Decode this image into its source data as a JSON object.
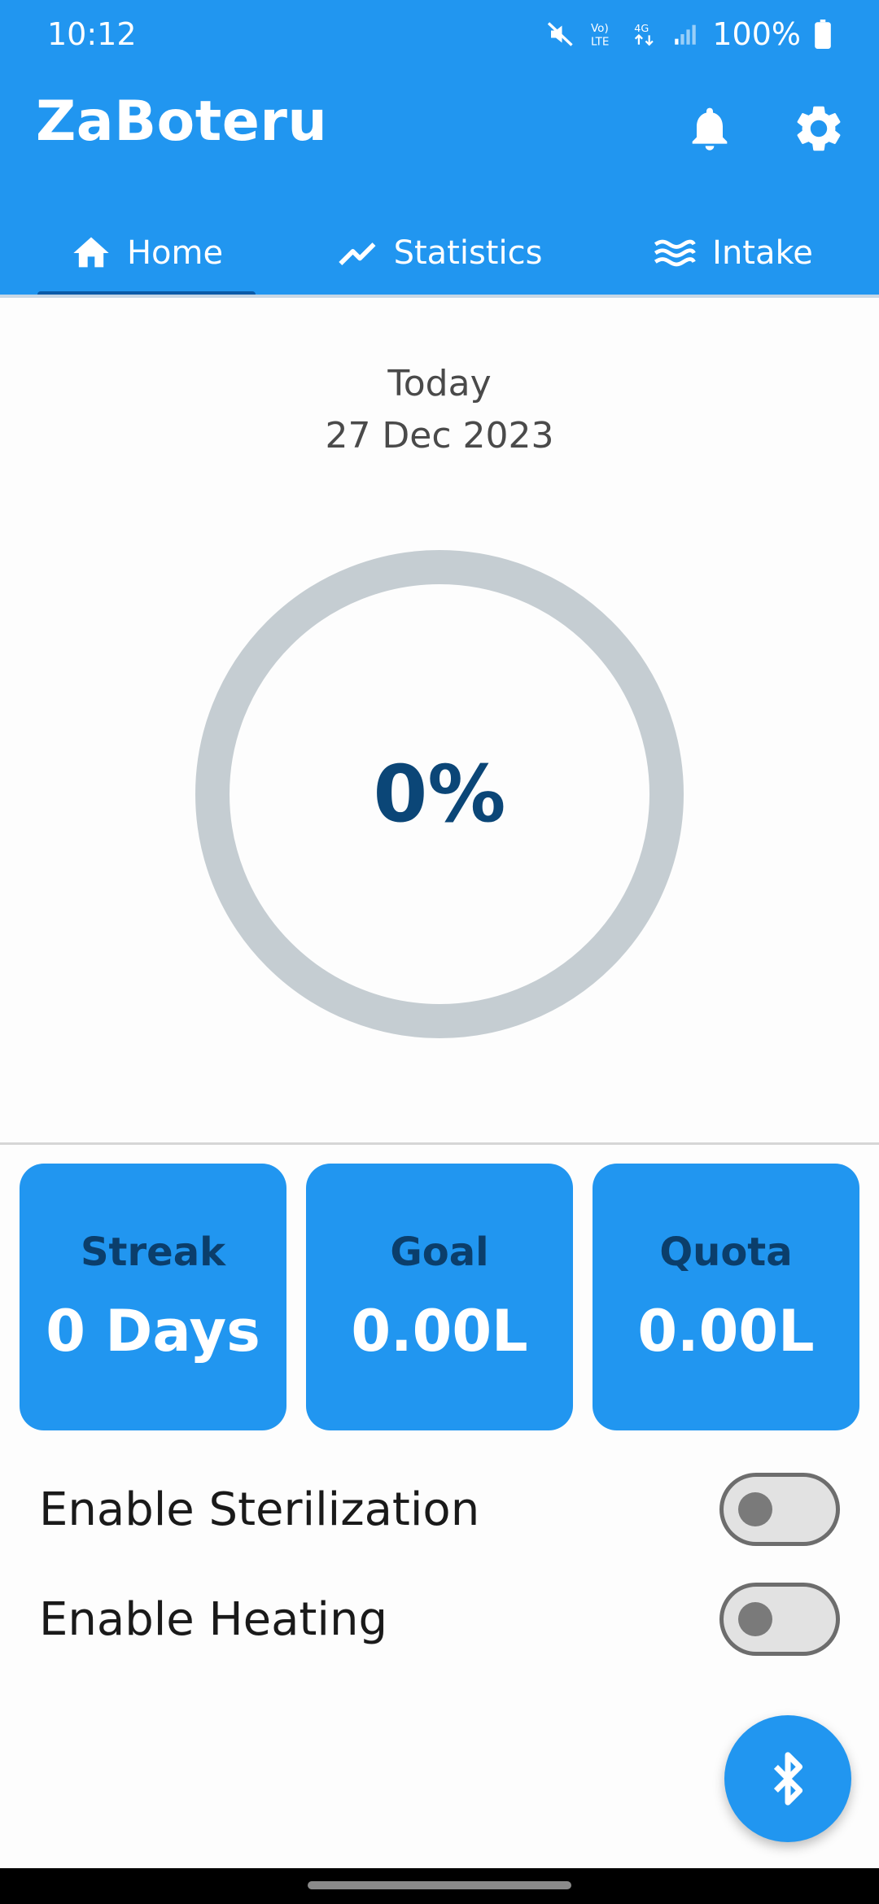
{
  "status_bar": {
    "time": "10:12",
    "battery": "100%",
    "icons": [
      "mute-icon",
      "volte-icon",
      "4g-icon",
      "signal-icon",
      "battery-icon"
    ]
  },
  "app_bar": {
    "title": "ZaBoteru",
    "actions": [
      "bell-icon",
      "gear-icon"
    ],
    "tabs": [
      {
        "label": "Home",
        "icon": "home-icon",
        "selected": true
      },
      {
        "label": "Statistics",
        "icon": "trending-icon",
        "selected": false
      },
      {
        "label": "Intake",
        "icon": "waves-icon",
        "selected": false
      }
    ]
  },
  "date": {
    "label": "Today",
    "value": "27 Dec 2023"
  },
  "progress": {
    "percent_label": "0%",
    "value": 0
  },
  "cards": [
    {
      "label": "Streak",
      "value": "0 Days"
    },
    {
      "label": "Goal",
      "value": "0.00L"
    },
    {
      "label": "Quota",
      "value": "0.00L"
    }
  ],
  "toggles": [
    {
      "label": "Enable Sterilization",
      "on": false
    },
    {
      "label": "Enable Heating",
      "on": false
    }
  ],
  "fab": {
    "icon": "bluetooth-icon"
  },
  "colors": {
    "primary": "#2196f0",
    "card_label": "#0b3e6b",
    "progress_text": "#0b4677",
    "ring_track": "#c5cdd2"
  }
}
